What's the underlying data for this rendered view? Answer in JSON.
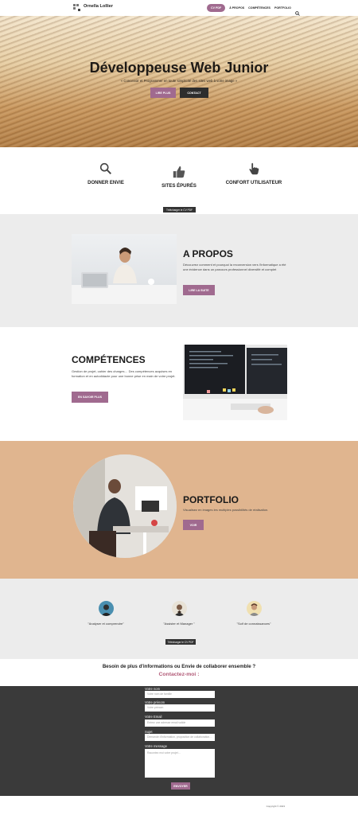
{
  "header": {
    "brand": "Ornella Lollier",
    "nav_cv": "CV PDF",
    "nav_items": [
      "À PROPOS",
      "COMPÉTENCES",
      "PORTFOLIO"
    ],
    "search_icon": "search-icon"
  },
  "hero": {
    "title": "Développeuse Web Junior",
    "subtitle": "« Concevoir et Programmer en toute simplicité des sites web à votre image »",
    "more_button": "LIRE PLUS",
    "contact_button": "CONTACT"
  },
  "features": {
    "items": [
      {
        "label": "DONNER ENVIE",
        "icon": "magnifier-icon"
      },
      {
        "label": "SITES ÉPURÉS",
        "icon": "thumbs-up-icon"
      },
      {
        "label": "CONFORT UTILISATEUR",
        "icon": "hand-cursor-icon"
      }
    ],
    "cv_button": "Télécharger le CV PDF"
  },
  "about": {
    "title": "A PROPOS",
    "text": "Découvrez comment et pourquoi la reconversion vers l'informatique a été une évidence dans un parcours professionnel diversifié et complet",
    "button": "LIRE LA SUITE"
  },
  "skills": {
    "title": "COMPÉTENCES",
    "text": "Gestion de projet, cahier des charges… Des compétences acquises en formation et en autodidacte pour une bonne prise en main de votre projet.",
    "button": "EN SAVOIR PLUS"
  },
  "portfolio": {
    "title": "PORTFOLIO",
    "text": "Visualisez en images les multiples possibilités de réalisation.",
    "button": "VOIR"
  },
  "testimonials": {
    "items": [
      {
        "label": "\"Analyser et comprendre\""
      },
      {
        "label": "\"Assister et Manager \""
      },
      {
        "label": "\"Soif de connaissances\""
      }
    ],
    "cv_button": "Télécharger le CV PDF"
  },
  "cta": {
    "question": "Besoin de plus d'informations ou Envie de collaborer ensemble ?",
    "contact": "Contactez-moi :"
  },
  "form": {
    "name_label": "Votre nom",
    "name_placeholder": "Votre nom de famille",
    "firstname_label": "Votre prénom",
    "firstname_placeholder": "Votre prénom",
    "email_label": "Votre Email",
    "email_placeholder": "Entrez une adresse email valide",
    "subject_label": "Sujet",
    "subject_placeholder": "Demande d'information, proposition de collaboration…",
    "message_label": "Votre message",
    "message_placeholder": "Racontez moi votre projet…",
    "submit": "ENVOYER"
  },
  "footer": {
    "copyright": "Copyright © 2023"
  },
  "colors": {
    "accent": "#a06a8f",
    "dark": "#2d2d2d",
    "portfolio_bg": "#e0b58f",
    "cta": "#b25b78"
  }
}
